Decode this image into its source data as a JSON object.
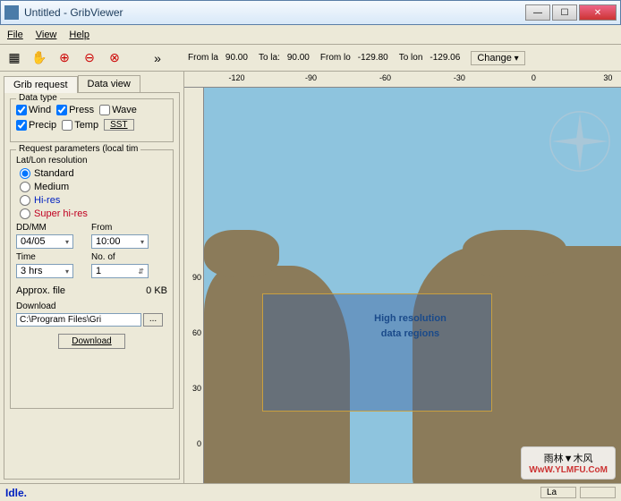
{
  "window": {
    "title": "Untitled - GribViewer"
  },
  "menu": {
    "file": "File",
    "view": "View",
    "help": "Help"
  },
  "toolbar": {
    "from_la_label": "From la",
    "from_la": "90.00",
    "to_la_label": "To la:",
    "to_la": "90.00",
    "from_lo_label": "From lo",
    "from_lo": "-129.80",
    "to_lo_label": "To lon",
    "to_lo": "-129.06",
    "change": "Change"
  },
  "tabs": {
    "grib": "Grib request",
    "data": "Data view"
  },
  "datatype": {
    "title": "Data type",
    "wind": "Wind",
    "press": "Press",
    "wave": "Wave",
    "precip": "Precip",
    "temp": "Temp",
    "sst": "SST"
  },
  "request": {
    "title": "Request parameters (local tim",
    "resolution_label": "Lat/Lon resolution",
    "standard": "Standard",
    "medium": "Medium",
    "hires": "Hi-res",
    "superhires": "Super hi-res",
    "ddmm_label": "DD/MM",
    "ddmm": "04/05",
    "from_label": "From",
    "from": "10:00",
    "time_label": "Time",
    "time": "3 hrs",
    "noof_label": "No. of",
    "noof": "1",
    "approx_label": "Approx. file",
    "approx_val": "0 KB",
    "download_label": "Download",
    "path": "C:\\Program Files\\Gri",
    "download_btn": "Download"
  },
  "map": {
    "lon_ticks": [
      "-120",
      "-90",
      "-60",
      "-30",
      "0",
      "30"
    ],
    "lat_ticks": [
      "90",
      "60",
      "30",
      "0"
    ],
    "selection_label1": "High resolution",
    "selection_label2": "data regions"
  },
  "status": {
    "idle": "Idle.",
    "la": "La"
  },
  "watermark": {
    "name": "雨林▼木风",
    "site": "WwW.YLMFU.CoM"
  }
}
